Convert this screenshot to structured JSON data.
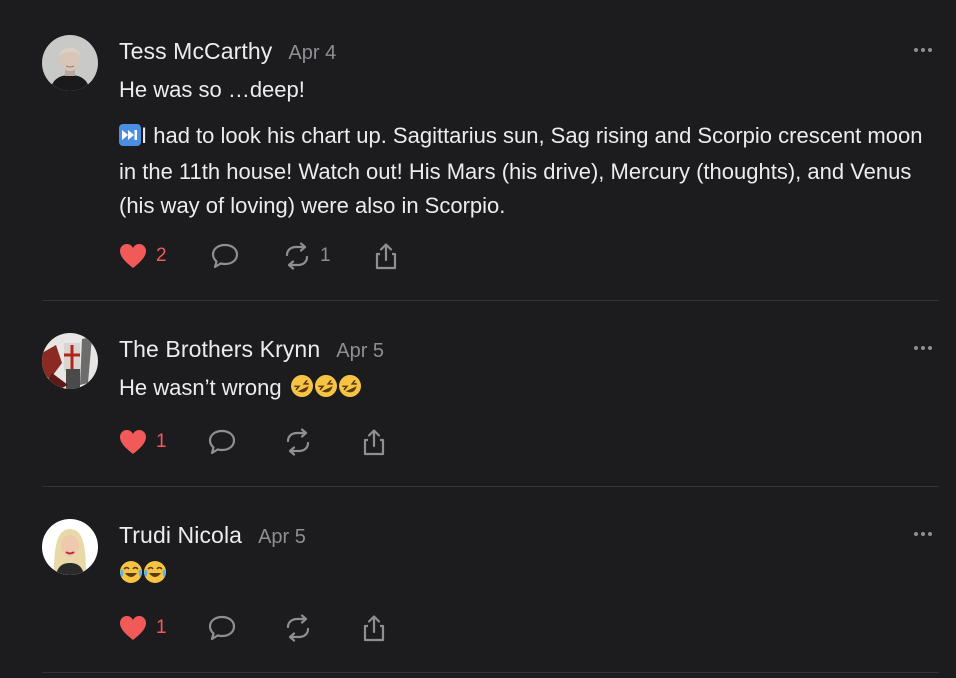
{
  "colors": {
    "background": "#1c1c1e",
    "text": "#ececec",
    "muted": "#8e8e93",
    "like": "#f25a5a",
    "divider": "#333336"
  },
  "comments": [
    {
      "author": "Tess McCarthy",
      "date": "Apr 4",
      "paragraphs": [
        "He was so …deep!",
        "I had to look his chart up. Sagittarius sun, Sag rising and Scorpio crescent moon in the 11th house! Watch out! His Mars (his drive), Mercury (thoughts), and Venus (his way of loving) were also in Scorpio."
      ],
      "leading_icon": "next-track-emoji",
      "likes": "2",
      "reposts": "1"
    },
    {
      "author": "The Brothers Krynn",
      "date": "Apr 5",
      "paragraphs": [
        "He wasn’t wrong"
      ],
      "trailing_emoji": [
        "rofl-emoji",
        "rofl-emoji",
        "rofl-emoji"
      ],
      "likes": "1"
    },
    {
      "author": "Trudi Nicola",
      "date": "Apr 5",
      "emoji_only": [
        "joy-emoji",
        "joy-emoji"
      ],
      "likes": "1"
    }
  ]
}
